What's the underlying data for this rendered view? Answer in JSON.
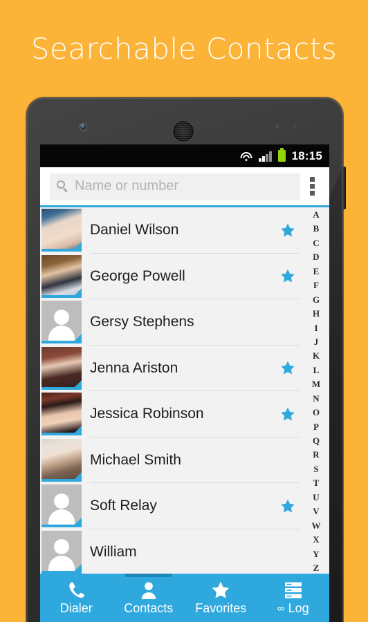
{
  "hero": {
    "title": "Searchable Contacts"
  },
  "colors": {
    "background_orange": "#FBB338",
    "accent_blue": "#2FA8DD",
    "nav_active_blue": "#1D87BB",
    "battery_green": "#93D406",
    "list_background": "#F2F2F2"
  },
  "status_bar": {
    "time": "18:15",
    "icons": [
      "wifi-icon",
      "signal-icon",
      "battery-icon"
    ],
    "signal_bars_total": 4,
    "signal_bars_active": 2
  },
  "search": {
    "placeholder": "Name or number",
    "value": "",
    "icon": "search-icon",
    "overflow_icon": "overflow-menu-icon"
  },
  "contacts": [
    {
      "name": "Daniel Wilson",
      "favorite": true,
      "avatar_type": "photo",
      "avatar_key": "daniel"
    },
    {
      "name": "George Powell",
      "favorite": true,
      "avatar_type": "photo",
      "avatar_key": "george"
    },
    {
      "name": "Gersy Stephens",
      "favorite": false,
      "avatar_type": "default",
      "avatar_key": ""
    },
    {
      "name": "Jenna Ariston",
      "favorite": true,
      "avatar_type": "photo",
      "avatar_key": "jenna"
    },
    {
      "name": "Jessica Robinson",
      "favorite": true,
      "avatar_type": "photo",
      "avatar_key": "jessica"
    },
    {
      "name": "Michael Smith",
      "favorite": false,
      "avatar_type": "photo",
      "avatar_key": "michael"
    },
    {
      "name": "Soft Relay",
      "favorite": true,
      "avatar_type": "default",
      "avatar_key": ""
    },
    {
      "name": "William",
      "favorite": false,
      "avatar_type": "default",
      "avatar_key": ""
    }
  ],
  "alpha_index": [
    "A",
    "B",
    "C",
    "D",
    "E",
    "F",
    "G",
    "H",
    "I",
    "J",
    "K",
    "L",
    "M",
    "N",
    "O",
    "P",
    "Q",
    "R",
    "S",
    "T",
    "U",
    "V",
    "W",
    "X",
    "Y",
    "Z"
  ],
  "bottom_nav": {
    "active": "Contacts",
    "items": [
      {
        "label": "Dialer",
        "icon": "phone-icon",
        "active": false,
        "prefix": ""
      },
      {
        "label": "Contacts",
        "icon": "person-icon",
        "active": true,
        "prefix": ""
      },
      {
        "label": "Favorites",
        "icon": "star-icon",
        "active": false,
        "prefix": ""
      },
      {
        "label": "Log",
        "icon": "list-log-icon",
        "active": false,
        "prefix": "∞"
      }
    ]
  }
}
